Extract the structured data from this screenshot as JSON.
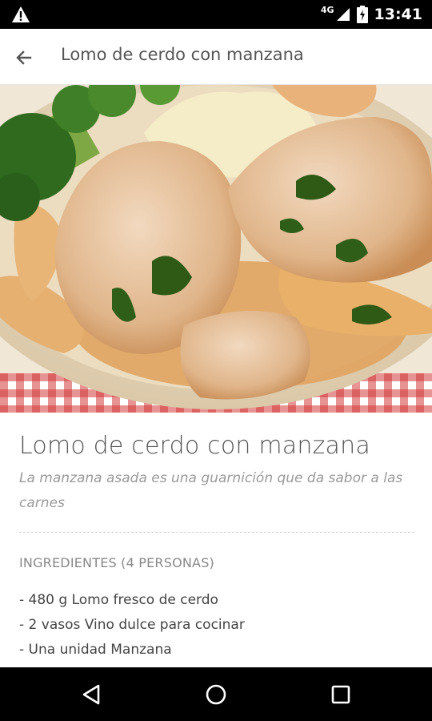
{
  "status_bar": {
    "network": "4G",
    "time": "13:41",
    "icons": [
      "warning-icon",
      "signal-icon",
      "battery-icon"
    ]
  },
  "app_bar": {
    "back_icon": "arrow-left-icon",
    "title": "Lomo de cerdo con manzana"
  },
  "hero_image": {
    "alt": "Lomo de cerdo con manzana"
  },
  "recipe": {
    "title": "Lomo de cerdo con manzana",
    "description": "La manzana asada es una guarnición que da sabor a las carnes",
    "ingredients_header": "INGREDIENTES (4 PERSONAS)",
    "ingredients": [
      "- 480 g Lomo fresco de cerdo",
      "- 2 vasos Vino dulce para cocinar",
      "- Una unidad Manzana"
    ]
  },
  "nav_bar": {
    "icons": [
      "back-triangle-icon",
      "home-circle-icon",
      "recents-square-icon"
    ]
  }
}
